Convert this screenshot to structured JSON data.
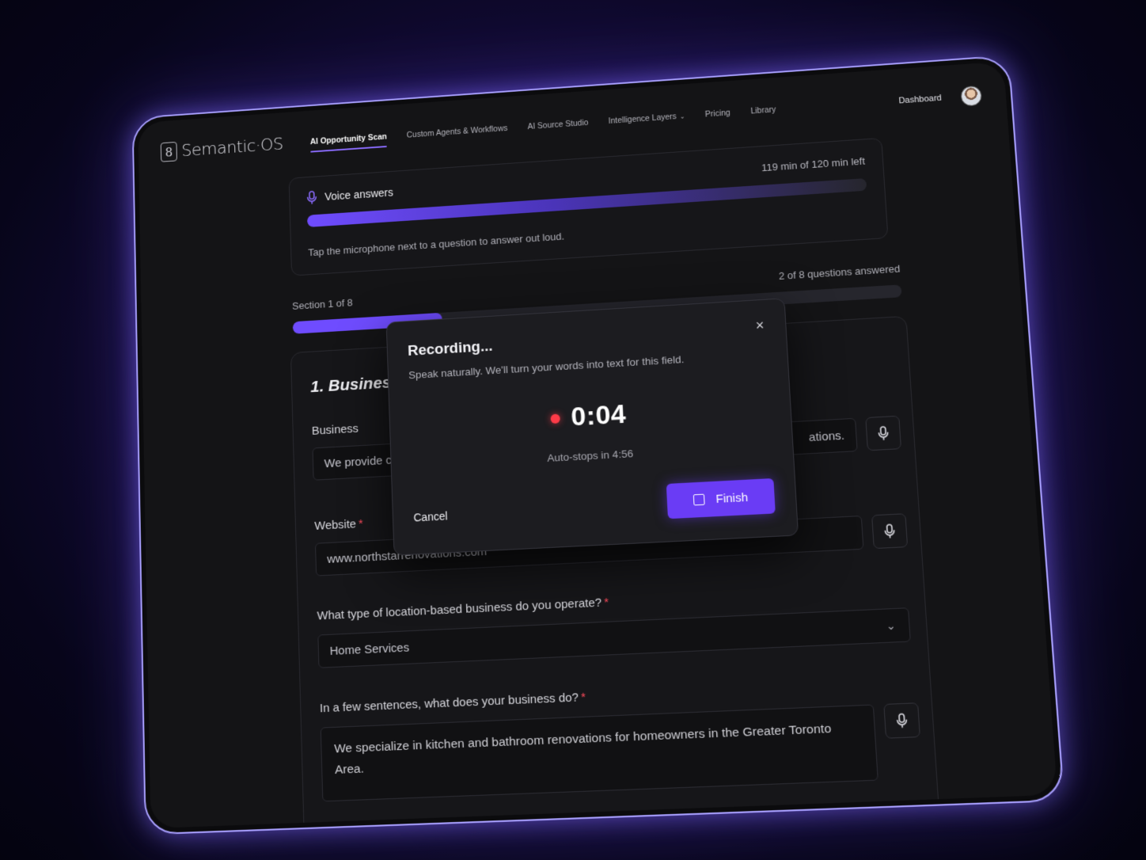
{
  "app": {
    "logo_mark": "8",
    "logo_text": "Semantic·OS"
  },
  "nav": {
    "links": [
      {
        "label": "AI Opportunity Scan",
        "active": true
      },
      {
        "label": "Custom Agents & Workflows"
      },
      {
        "label": "AI Source Studio"
      },
      {
        "label": "Intelligence Layers"
      },
      {
        "label": "Pricing"
      },
      {
        "label": "Library"
      }
    ],
    "dashboard": "Dashboard"
  },
  "voice": {
    "title": "Voice answers",
    "time_left": "119 min of 120 min left",
    "used_fraction": 0.01,
    "hint": "Tap the microphone next to a question to answer out loud."
  },
  "section": {
    "label": "Section 1 of 8",
    "answered": "2 of 8 questions answered",
    "progress_fraction": 0.25
  },
  "form": {
    "heading": "1.  Business",
    "business_label": "Business",
    "business_value_start": "We provide co",
    "business_value_end": "ations.",
    "website_label": "Website",
    "website_value": "www.northstarrenovations.com",
    "type_label": "What type of location-based business do you operate?",
    "type_value": "Home Services",
    "desc_label": "In a few sentences, what does your business do?",
    "desc_value": "We specialize in kitchen and bathroom renovations for homeowners in the Greater Toronto Area.",
    "required_mark": "*"
  },
  "modal": {
    "title": "Recording...",
    "subtitle": "Speak naturally. We'll turn your words into text for this field.",
    "timer": "0:04",
    "auto_stop": "Auto-stops in 4:56",
    "cancel": "Cancel",
    "finish": "Finish",
    "close_glyph": "×"
  },
  "colors": {
    "accent": "#6a3cf5",
    "record": "#ff3b48",
    "required": "#ff4b5c"
  }
}
